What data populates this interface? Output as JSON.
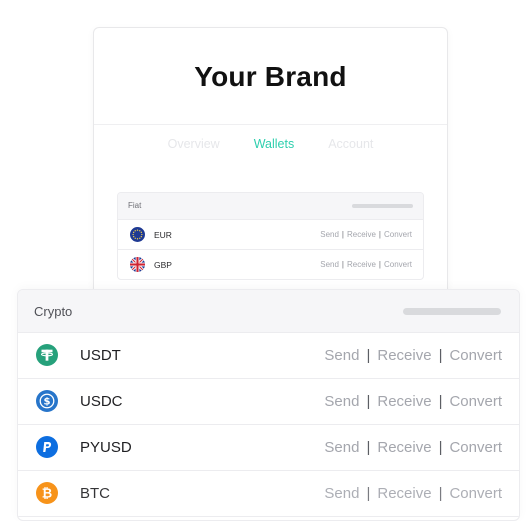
{
  "brand": {
    "title": "Your Brand"
  },
  "tabs": [
    {
      "label": "Overview",
      "active": false
    },
    {
      "label": "Wallets",
      "active": true
    },
    {
      "label": "Account",
      "active": false
    }
  ],
  "fiat": {
    "title": "Fiat",
    "rows": [
      {
        "code": "EUR",
        "icon": "eu-flag-icon",
        "send": "Send",
        "receive": "Receive",
        "convert": "Convert"
      },
      {
        "code": "GBP",
        "icon": "uk-flag-icon",
        "send": "Send",
        "receive": "Receive",
        "convert": "Convert"
      }
    ]
  },
  "crypto": {
    "title": "Crypto",
    "rows": [
      {
        "code": "USDT",
        "icon": "tether-icon",
        "color": "#26a17b",
        "send": "Send",
        "receive": "Receive",
        "convert": "Convert"
      },
      {
        "code": "USDC",
        "icon": "usdc-icon",
        "color": "#2775ca",
        "send": "Send",
        "receive": "Receive",
        "convert": "Convert"
      },
      {
        "code": "PYUSD",
        "icon": "paypal-icon",
        "color": "#0d6ee0",
        "send": "Send",
        "receive": "Receive",
        "convert": "Convert"
      },
      {
        "code": "BTC",
        "icon": "bitcoin-icon",
        "color": "#f7931a",
        "send": "Send",
        "receive": "Receive",
        "convert": "Convert"
      }
    ]
  },
  "colors": {
    "accent": "#2ecfae",
    "muted_text": "#a4a6ad",
    "panel_header": "#f6f6f8"
  }
}
